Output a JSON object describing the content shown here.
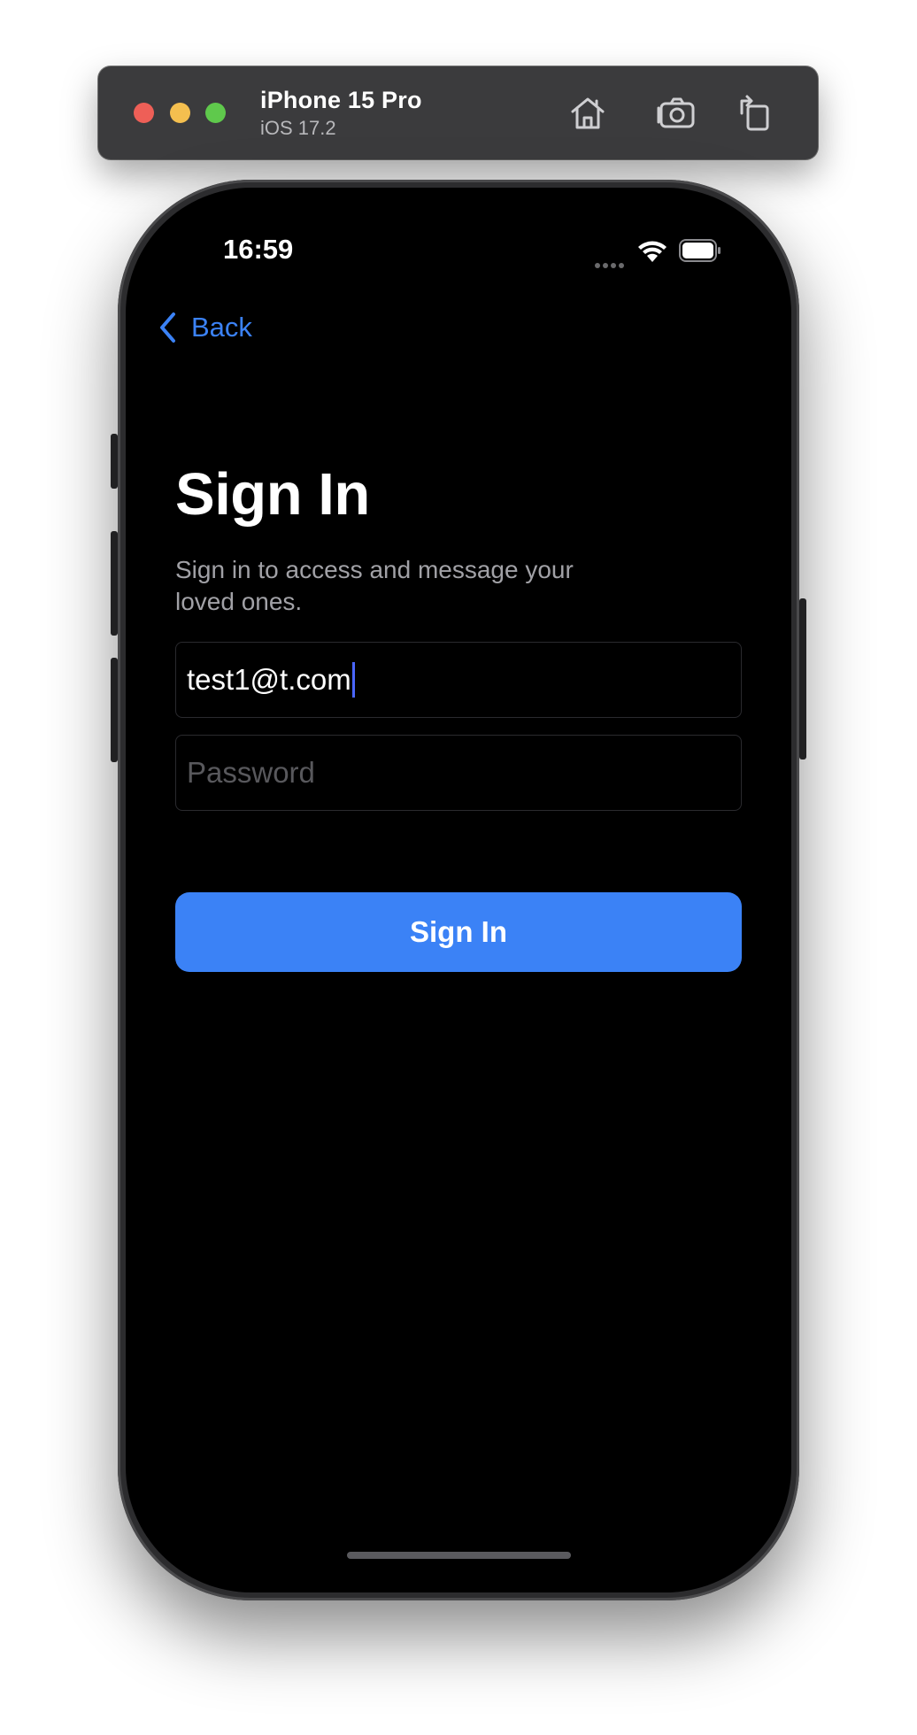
{
  "simulator": {
    "device_name": "iPhone 15 Pro",
    "os_version": "iOS 17.2",
    "toolbar_icons": [
      "home-icon",
      "screenshot-icon",
      "rotate-icon"
    ]
  },
  "status_bar": {
    "time": "16:59",
    "icons": [
      "cellular-signal-icon",
      "wifi-icon",
      "battery-icon"
    ]
  },
  "navigation": {
    "back_label": "Back"
  },
  "screen": {
    "title": "Sign In",
    "subtitle": "Sign in to access and message your loved ones.",
    "email_value": "test1@t.com",
    "password_placeholder": "Password",
    "submit_label": "Sign In"
  },
  "colors": {
    "accent": "#3b82f6",
    "background": "#000000",
    "caret": "#4a66ff"
  }
}
